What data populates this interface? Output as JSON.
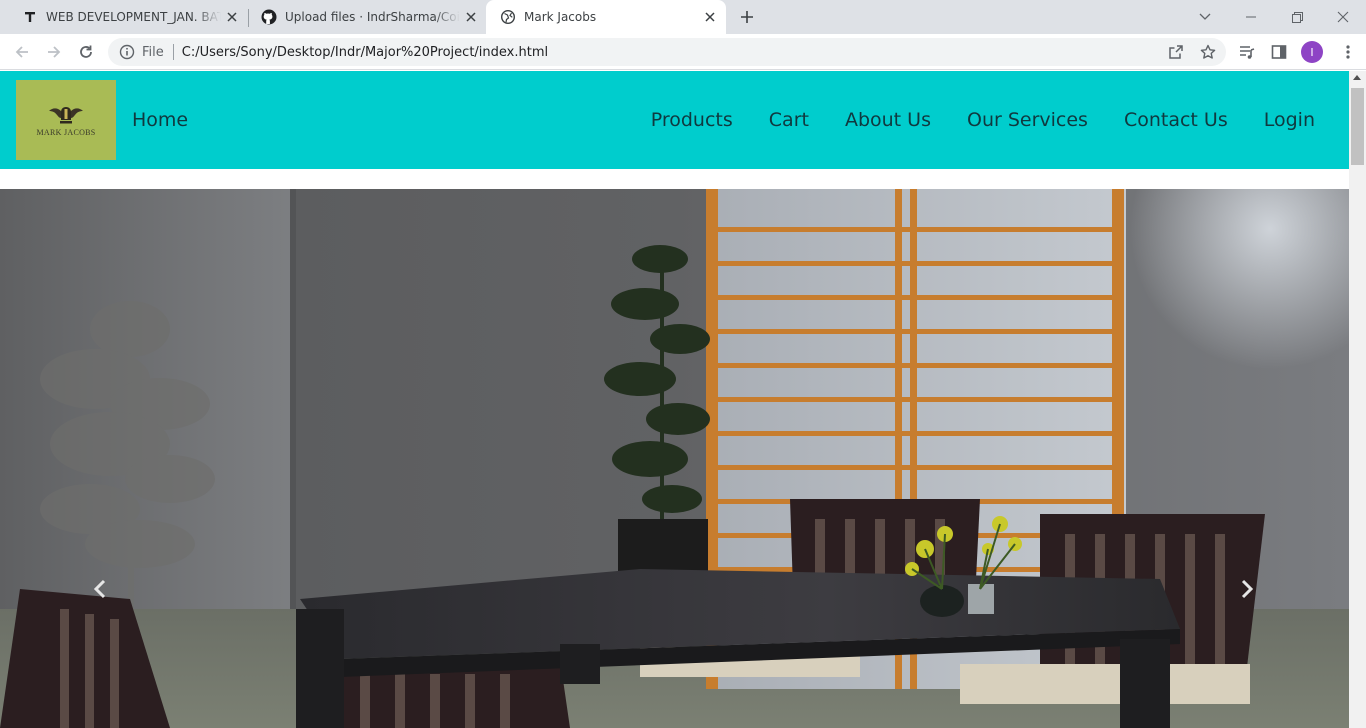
{
  "browser": {
    "tabs": [
      {
        "title": "WEB DEVELOPMENT_JAN. BATCH",
        "icon": "t-logo-icon"
      },
      {
        "title": "Upload files · IndrSharma/Coincex",
        "icon": "github-icon"
      },
      {
        "title": "Mark Jacobs",
        "icon": "globe-icon"
      }
    ],
    "url_scheme": "File",
    "url": "C:/Users/Sony/Desktop/Indr/Major%20Project/index.html",
    "profile_initial": "I"
  },
  "page": {
    "logo_text": "MARK JACOBS",
    "nav": {
      "home": "Home",
      "links": [
        "Products",
        "Cart",
        "About Us",
        "Our Services",
        "Contact Us",
        "Login"
      ]
    },
    "colors": {
      "navbar": "#00cdcd",
      "logo_bg": "#a9bb55"
    }
  }
}
